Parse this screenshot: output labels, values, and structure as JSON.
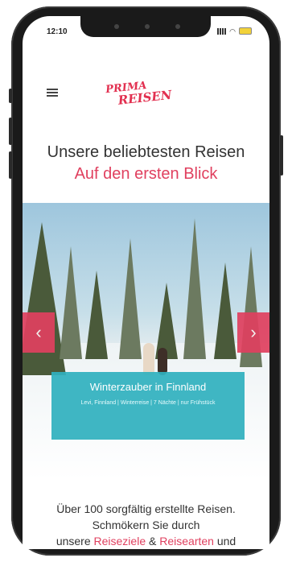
{
  "status": {
    "time": "12:10"
  },
  "header": {
    "logo_line1": "PRIMA",
    "logo_line2": "REISEN"
  },
  "headline": {
    "title": "Unsere beliebtesten Reisen",
    "subtitle": "Auf den ersten Blick"
  },
  "slider": {
    "prev_label": "‹",
    "next_label": "›",
    "caption_title": "Winterzauber in Finnland",
    "caption_desc": "Levi, Finnland | Winterreise | 7 Nächte | nur Frühstück"
  },
  "intro": {
    "line1": "Über 100 sorgfältig erstellte Reisen.",
    "line2": "Schmökern Sie durch",
    "line3_pre": "unsere ",
    "link_destinations": "Reiseziele",
    "line3_mid": " & ",
    "link_types": "Reisearten",
    "line3_post": " und"
  },
  "colors": {
    "accent": "#e0405f",
    "caption_bg": "#30b0be"
  },
  "icons": {
    "menu": "hamburger-menu-icon",
    "signal": "signal-icon",
    "wifi": "wifi-icon",
    "battery": "battery-icon"
  }
}
